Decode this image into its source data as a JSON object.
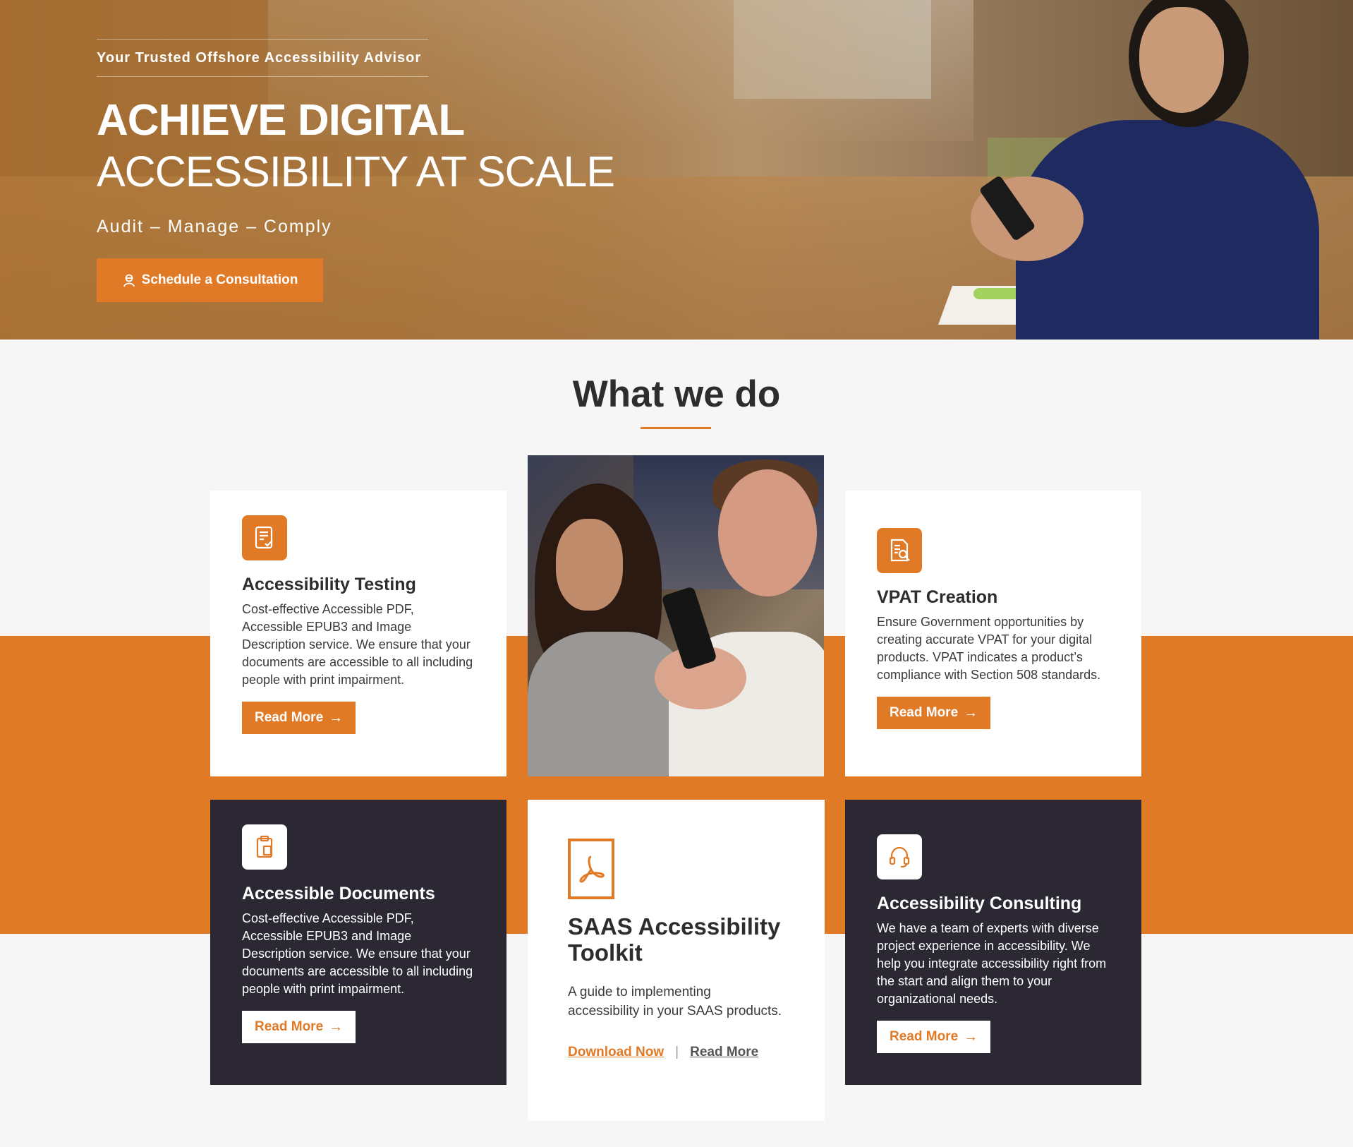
{
  "hero": {
    "tagline": "Your Trusted Offshore Accessibility Advisor",
    "title_line1": "ACHIEVE DIGITAL",
    "title_line2": "ACCESSIBILITY AT SCALE",
    "subtitle": "Audit – Manage – Comply",
    "cta_label": "Schedule a Consultation",
    "cta_icon": "user-icon"
  },
  "section": {
    "title": "What we do"
  },
  "cards": {
    "testing": {
      "icon": "checklist-icon",
      "title": "Accessibility Testing",
      "text": "Cost-effective Accessible PDF, Accessible EPUB3 and Image Description service. We ensure that your documents are accessible to all including people with print impairment.",
      "button": "Read More"
    },
    "vpat": {
      "icon": "document-search-icon",
      "title": "VPAT Creation",
      "text": "Ensure Government opportunities by creating accurate VPAT for your digital products. VPAT indicates a product’s compliance with Section 508 standards.",
      "button": "Read More"
    },
    "documents": {
      "icon": "clipboard-icon",
      "title": "Accessible Documents",
      "text": "Cost-effective Accessible PDF, Accessible EPUB3 and Image Description service. We ensure that your documents are accessible to all including people with print impairment.",
      "button": "Read More"
    },
    "saas": {
      "icon": "pdf-icon",
      "title": "SAAS Accessibility Toolkit",
      "text": "A guide to implementing accessibility in your SAAS products.",
      "download": "Download Now",
      "separator": "|",
      "read_more": "Read More"
    },
    "consulting": {
      "icon": "headset-icon",
      "title": "Accessibility Consulting",
      "text": "We have a team of experts with diverse project experience in accessibility. We help you integrate accessibility right from the start and align them to your organizational needs.",
      "button": "Read More"
    }
  },
  "colors": {
    "accent": "#e07a26",
    "dark": "#2b2733",
    "background": "#f6f6f6"
  }
}
